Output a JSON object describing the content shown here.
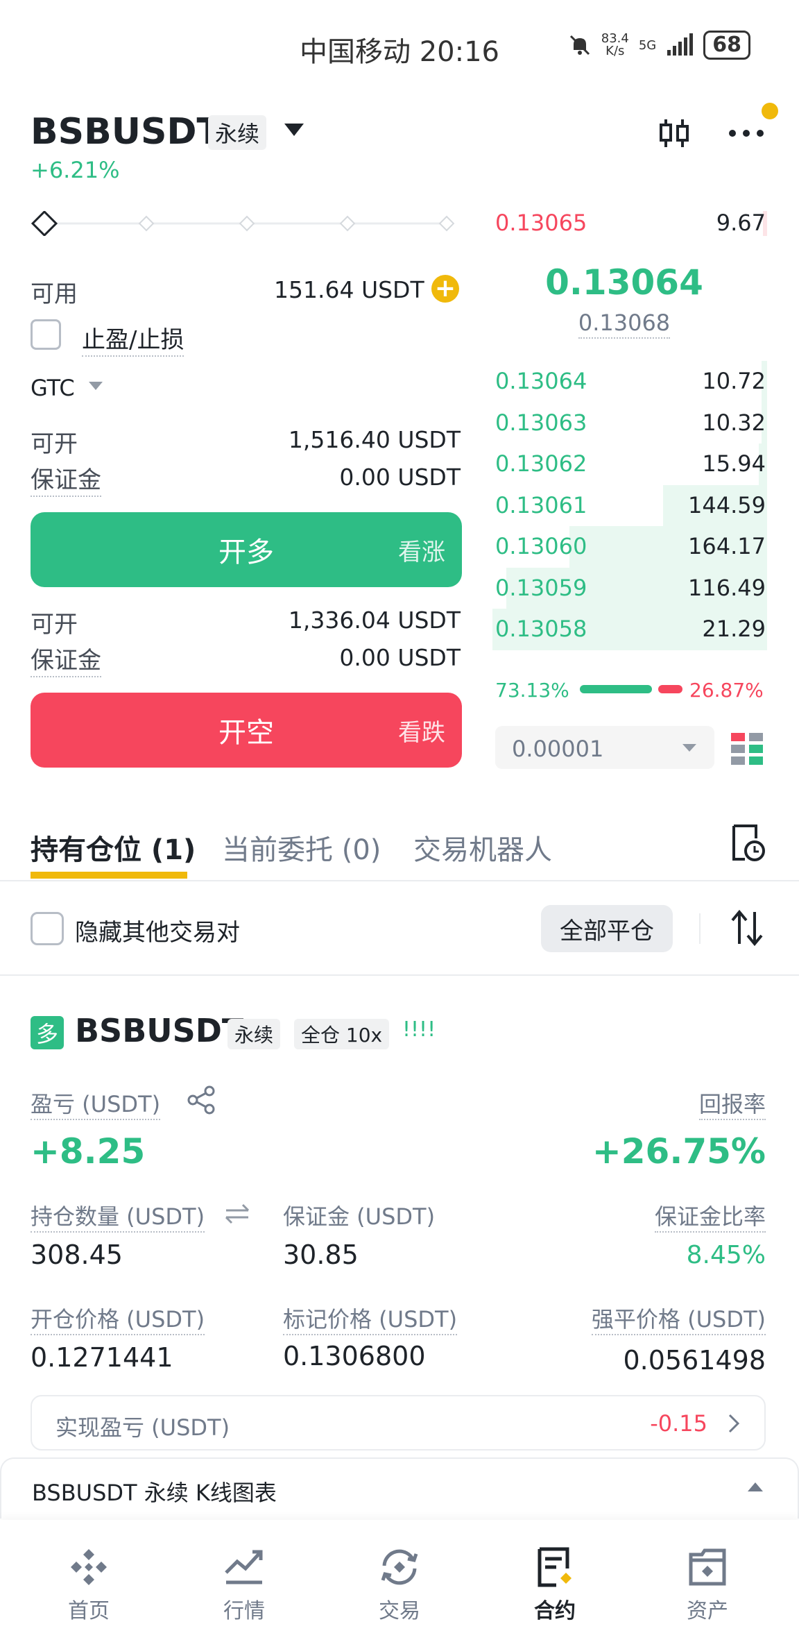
{
  "status_bar": {
    "carrier": "中国移动",
    "time": "20:16",
    "net_speed": "83.4",
    "net_unit": "K/s",
    "network": "5G",
    "battery": "68"
  },
  "header": {
    "pair": "BSBUSDT",
    "contract_type": "永续",
    "change": "+6.21%"
  },
  "trade": {
    "available_label": "可用",
    "available_value": "151.64 USDT",
    "tpsl_label": "止盈/止损",
    "tif": "GTC",
    "long": {
      "max_label": "可开",
      "max_value": "1,516.40 USDT",
      "margin_label": "保证金",
      "margin_value": "0.00 USDT",
      "button": "开多",
      "button_sub": "看涨"
    },
    "short": {
      "max_label": "可开",
      "max_value": "1,336.04 USDT",
      "margin_label": "保证金",
      "margin_value": "0.00 USDT",
      "button": "开空",
      "button_sub": "看跌"
    }
  },
  "orderbook": {
    "ask": {
      "price": "0.13065",
      "qty": "9.67"
    },
    "last_price": "0.13064",
    "mark_price": "0.13068",
    "bids": [
      {
        "price": "0.13064",
        "qty": "10.72",
        "depth": 0.02
      },
      {
        "price": "0.13063",
        "qty": "10.32",
        "depth": 0.02
      },
      {
        "price": "0.13062",
        "qty": "15.94",
        "depth": 0.03
      },
      {
        "price": "0.13061",
        "qty": "144.59",
        "depth": 0.38
      },
      {
        "price": "0.13060",
        "qty": "164.17",
        "depth": 0.72
      },
      {
        "price": "0.13059",
        "qty": "116.49",
        "depth": 0.95
      },
      {
        "price": "0.13058",
        "qty": "21.29",
        "depth": 1.0
      }
    ],
    "buy_ratio": "73.13%",
    "sell_ratio": "26.87%",
    "buy_ratio_value": 73.13,
    "precision": "0.00001"
  },
  "tabs": [
    {
      "label": "持有仓位 (1)"
    },
    {
      "label": "当前委托 (0)"
    },
    {
      "label": "交易机器人"
    }
  ],
  "filter": {
    "hide_label": "隐藏其他交易对",
    "close_all": "全部平仓"
  },
  "position": {
    "side": "多",
    "pair": "BSBUSDT",
    "type": "永续",
    "margin_mode": "全仓 10x",
    "signal": "!!!!",
    "pnl_label": "盈亏 (USDT)",
    "pnl_value": "+8.25",
    "roe_label": "回报率",
    "roe_value": "+26.75%",
    "size_label": "持仓数量 (USDT)",
    "size_value": "308.45",
    "margin_label": "保证金 (USDT)",
    "margin_value": "30.85",
    "margin_ratio_label": "保证金比率",
    "margin_ratio_value": "8.45%",
    "entry_label": "开仓价格 (USDT)",
    "entry_value": "0.1271441",
    "mark_label": "标记价格 (USDT)",
    "mark_value": "0.1306800",
    "liq_label": "强平价格 (USDT)",
    "liq_value": "0.0561498",
    "realized_label": "实现盈亏 (USDT)",
    "realized_value": "-0.15"
  },
  "kline_bar": {
    "label": "BSBUSDT 永续 K线图表"
  },
  "nav": [
    {
      "label": "首页",
      "icon": "home-icon"
    },
    {
      "label": "行情",
      "icon": "markets-icon"
    },
    {
      "label": "交易",
      "icon": "trade-icon"
    },
    {
      "label": "合约",
      "icon": "futures-icon"
    },
    {
      "label": "资产",
      "icon": "wallet-icon"
    }
  ]
}
